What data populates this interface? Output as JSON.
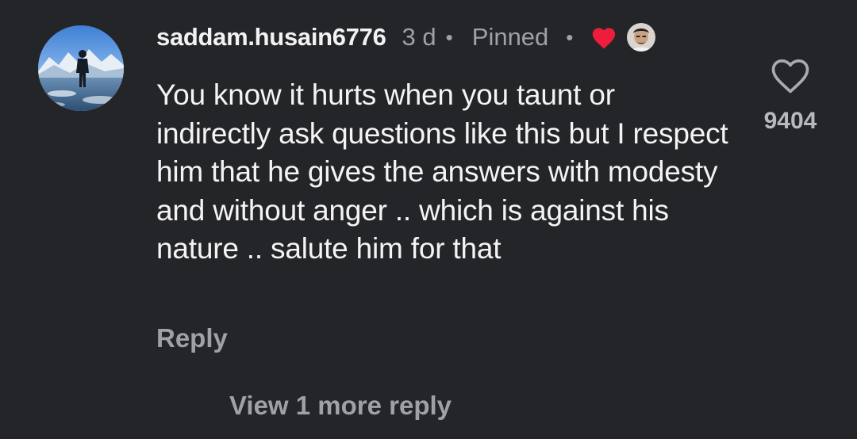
{
  "comment": {
    "username": "saddam.husain6776",
    "time_ago": "3 d",
    "separator": "•",
    "pinned_label": "Pinned",
    "body": "You know it hurts when you taunt or indirectly ask questions like this but I respect him that he gives the answers with modesty and without anger .. which is against his nature .. salute him for that",
    "reply_label": "Reply",
    "like_count": "9404",
    "view_more_label": "View 1 more reply"
  },
  "icons": {
    "creator_heart": "heart-filled-icon",
    "like": "heart-outline-icon"
  },
  "colors": {
    "background": "#242528",
    "primary_text": "#f2f2f2",
    "secondary_text": "#a0a1a5",
    "creator_heart": "#ee1d3b"
  }
}
